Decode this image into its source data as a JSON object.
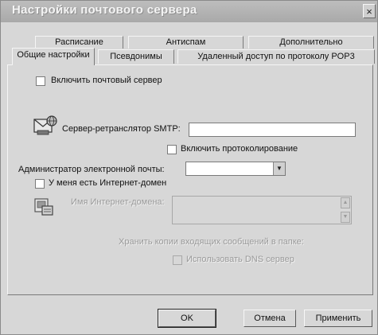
{
  "window": {
    "title": "Настройки почтового сервера",
    "close_glyph": "×"
  },
  "tabs_back": [
    {
      "label": "Расписание"
    },
    {
      "label": "Антиспам"
    },
    {
      "label": "Дополнительно"
    }
  ],
  "tabs_front": [
    {
      "label": "Общие настройки",
      "active": true
    },
    {
      "label": "Псевдонимы"
    },
    {
      "label": "Удаленный доступ по протоколу POP3"
    }
  ],
  "general": {
    "enable_server": {
      "label": "Включить почтовый сервер",
      "checked": false
    },
    "smtp_relay": {
      "label": "Сервер-ретранслятор SMTP:",
      "value": ""
    },
    "enable_logging": {
      "label": "Включить протоколирование",
      "checked": false
    },
    "admin_email": {
      "label": "Администратор электронной почты:",
      "value": ""
    }
  },
  "internet_domain": {
    "checkbox": {
      "label": "У меня есть Интернет-домен",
      "checked": false
    },
    "domain_name_label": "Имя Интернет-домена:",
    "mail_store_label": "Хранить копии входящих сообщений в папке:",
    "use_dns_label": "Использовать DNS сервер"
  },
  "buttons": {
    "ok": "OK",
    "cancel": "Отмена",
    "apply": "Применить"
  },
  "icons": {
    "smtp": "mail-server-icon",
    "domain": "domain-icon"
  }
}
